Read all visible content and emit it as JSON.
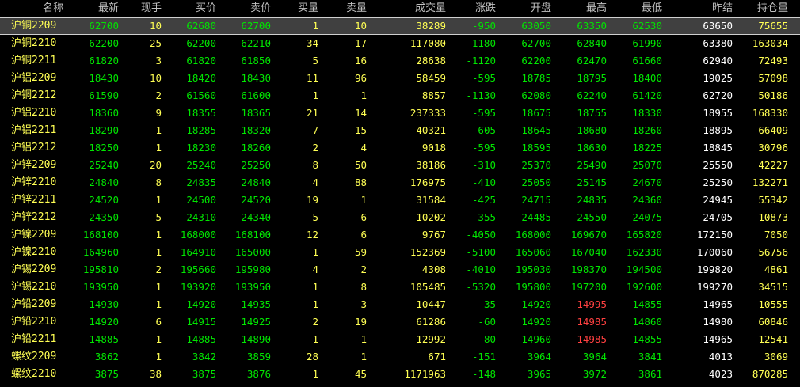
{
  "columns": [
    "名称",
    "最新",
    "现手",
    "买价",
    "卖价",
    "买量",
    "卖量",
    "成交量",
    "涨跌",
    "开盘",
    "最高",
    "最低",
    "昨结",
    "持仓量"
  ],
  "colors": {
    "up": "#ff4040",
    "down": "#00e600",
    "neutral": "#ffffff",
    "volume": "#ffff54"
  },
  "selected_row": 0,
  "rows": [
    {
      "name": "沪铜",
      "code": "2209",
      "last": "62700",
      "cur": "10",
      "bid": "62680",
      "ask": "62700",
      "bidv": "1",
      "askv": "10",
      "vol": "38289",
      "chg": "-950",
      "open": "63050",
      "high": "63350",
      "low": "62530",
      "pre": "63650",
      "oi": "75655",
      "hc": "g"
    },
    {
      "name": "沪铜",
      "code": "2210",
      "last": "62200",
      "cur": "25",
      "bid": "62200",
      "ask": "62210",
      "bidv": "34",
      "askv": "17",
      "vol": "117080",
      "chg": "-1180",
      "open": "62700",
      "high": "62840",
      "low": "61990",
      "pre": "63380",
      "oi": "163034",
      "hc": "g"
    },
    {
      "name": "沪铜",
      "code": "2211",
      "last": "61820",
      "cur": "3",
      "bid": "61820",
      "ask": "61850",
      "bidv": "5",
      "askv": "16",
      "vol": "28638",
      "chg": "-1120",
      "open": "62200",
      "high": "62470",
      "low": "61660",
      "pre": "62940",
      "oi": "72493",
      "hc": "g"
    },
    {
      "name": "沪铝",
      "code": "2209",
      "last": "18430",
      "cur": "10",
      "bid": "18420",
      "ask": "18430",
      "bidv": "11",
      "askv": "96",
      "vol": "58459",
      "chg": "-595",
      "open": "18785",
      "high": "18795",
      "low": "18400",
      "pre": "19025",
      "oi": "57098",
      "hc": "g"
    },
    {
      "name": "沪铜",
      "code": "2212",
      "last": "61590",
      "cur": "2",
      "bid": "61560",
      "ask": "61600",
      "bidv": "1",
      "askv": "1",
      "vol": "8857",
      "chg": "-1130",
      "open": "62080",
      "high": "62240",
      "low": "61420",
      "pre": "62720",
      "oi": "50186",
      "hc": "g"
    },
    {
      "name": "沪铝",
      "code": "2210",
      "last": "18360",
      "cur": "9",
      "bid": "18355",
      "ask": "18365",
      "bidv": "21",
      "askv": "14",
      "vol": "237333",
      "chg": "-595",
      "open": "18675",
      "high": "18755",
      "low": "18330",
      "pre": "18955",
      "oi": "168330",
      "hc": "g"
    },
    {
      "name": "沪铝",
      "code": "2211",
      "last": "18290",
      "cur": "1",
      "bid": "18285",
      "ask": "18320",
      "bidv": "7",
      "askv": "15",
      "vol": "40321",
      "chg": "-605",
      "open": "18645",
      "high": "18680",
      "low": "18260",
      "pre": "18895",
      "oi": "66409",
      "hc": "g"
    },
    {
      "name": "沪铝",
      "code": "2212",
      "last": "18250",
      "cur": "1",
      "bid": "18230",
      "ask": "18260",
      "bidv": "2",
      "askv": "4",
      "vol": "9018",
      "chg": "-595",
      "open": "18595",
      "high": "18630",
      "low": "18225",
      "pre": "18845",
      "oi": "30796",
      "hc": "g"
    },
    {
      "name": "沪锌",
      "code": "2209",
      "last": "25240",
      "cur": "20",
      "bid": "25240",
      "ask": "25250",
      "bidv": "8",
      "askv": "50",
      "vol": "38186",
      "chg": "-310",
      "open": "25370",
      "high": "25490",
      "low": "25070",
      "pre": "25550",
      "oi": "42227",
      "hc": "g"
    },
    {
      "name": "沪锌",
      "code": "2210",
      "last": "24840",
      "cur": "8",
      "bid": "24835",
      "ask": "24840",
      "bidv": "4",
      "askv": "88",
      "vol": "176975",
      "chg": "-410",
      "open": "25050",
      "high": "25145",
      "low": "24670",
      "pre": "25250",
      "oi": "132271",
      "hc": "g"
    },
    {
      "name": "沪锌",
      "code": "2211",
      "last": "24520",
      "cur": "1",
      "bid": "24500",
      "ask": "24520",
      "bidv": "19",
      "askv": "1",
      "vol": "31584",
      "chg": "-425",
      "open": "24715",
      "high": "24835",
      "low": "24360",
      "pre": "24945",
      "oi": "55342",
      "hc": "g"
    },
    {
      "name": "沪锌",
      "code": "2212",
      "last": "24350",
      "cur": "5",
      "bid": "24310",
      "ask": "24340",
      "bidv": "5",
      "askv": "6",
      "vol": "10202",
      "chg": "-355",
      "open": "24485",
      "high": "24550",
      "low": "24075",
      "pre": "24705",
      "oi": "10873",
      "hc": "g"
    },
    {
      "name": "沪镍",
      "code": "2209",
      "last": "168100",
      "cur": "1",
      "bid": "168000",
      "ask": "168100",
      "bidv": "12",
      "askv": "6",
      "vol": "9767",
      "chg": "-4050",
      "open": "168000",
      "high": "169670",
      "low": "165820",
      "pre": "172150",
      "oi": "7050",
      "hc": "g"
    },
    {
      "name": "沪镍",
      "code": "2210",
      "last": "164960",
      "cur": "1",
      "bid": "164910",
      "ask": "165000",
      "bidv": "1",
      "askv": "59",
      "vol": "152369",
      "chg": "-5100",
      "open": "165060",
      "high": "167040",
      "low": "162330",
      "pre": "170060",
      "oi": "56756",
      "hc": "g"
    },
    {
      "name": "沪锡",
      "code": "2209",
      "last": "195810",
      "cur": "2",
      "bid": "195660",
      "ask": "195980",
      "bidv": "4",
      "askv": "2",
      "vol": "4308",
      "chg": "-4010",
      "open": "195030",
      "high": "198370",
      "low": "194500",
      "pre": "199820",
      "oi": "4861",
      "hc": "g"
    },
    {
      "name": "沪锡",
      "code": "2210",
      "last": "193950",
      "cur": "1",
      "bid": "193920",
      "ask": "193950",
      "bidv": "1",
      "askv": "8",
      "vol": "105485",
      "chg": "-5320",
      "open": "195800",
      "high": "197200",
      "low": "192600",
      "pre": "199270",
      "oi": "34515",
      "hc": "g"
    },
    {
      "name": "沪铅",
      "code": "2209",
      "last": "14930",
      "cur": "1",
      "bid": "14920",
      "ask": "14935",
      "bidv": "1",
      "askv": "3",
      "vol": "10447",
      "chg": "-35",
      "open": "14920",
      "high": "14995",
      "low": "14855",
      "pre": "14965",
      "oi": "10555",
      "hc": "r"
    },
    {
      "name": "沪铅",
      "code": "2210",
      "last": "14920",
      "cur": "6",
      "bid": "14915",
      "ask": "14925",
      "bidv": "2",
      "askv": "19",
      "vol": "61286",
      "chg": "-60",
      "open": "14920",
      "high": "14985",
      "low": "14860",
      "pre": "14980",
      "oi": "60846",
      "hc": "r"
    },
    {
      "name": "沪铅",
      "code": "2211",
      "last": "14885",
      "cur": "1",
      "bid": "14885",
      "ask": "14890",
      "bidv": "1",
      "askv": "1",
      "vol": "12992",
      "chg": "-80",
      "open": "14960",
      "high": "14985",
      "low": "14855",
      "pre": "14965",
      "oi": "12541",
      "hc": "r"
    },
    {
      "name": "螺纹",
      "code": "2209",
      "last": "3862",
      "cur": "1",
      "bid": "3842",
      "ask": "3859",
      "bidv": "28",
      "askv": "1",
      "vol": "671",
      "chg": "-151",
      "open": "3964",
      "high": "3964",
      "low": "3841",
      "pre": "4013",
      "oi": "3069",
      "hc": "g"
    },
    {
      "name": "螺纹",
      "code": "2210",
      "last": "3875",
      "cur": "38",
      "bid": "3875",
      "ask": "3876",
      "bidv": "1",
      "askv": "45",
      "vol": "1171963",
      "chg": "-148",
      "open": "3965",
      "high": "3972",
      "low": "3861",
      "pre": "4023",
      "oi": "870285",
      "hc": "g"
    }
  ]
}
